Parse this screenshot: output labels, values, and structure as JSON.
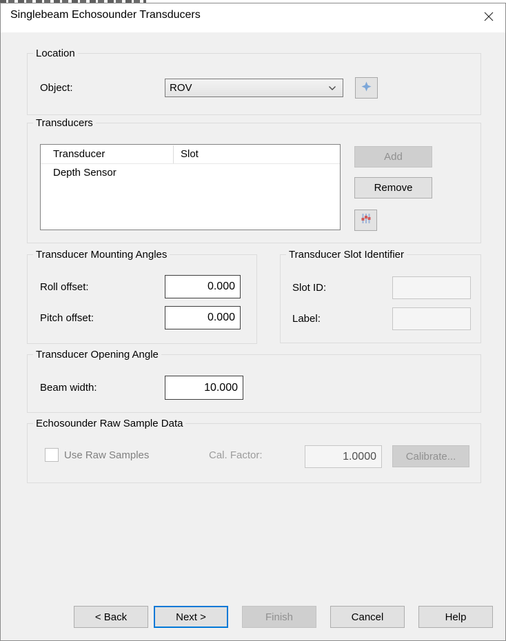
{
  "window": {
    "title": "Singlebeam Echosounder Transducers"
  },
  "location": {
    "legend": "Location",
    "object_label": "Object:",
    "object_value": "ROV"
  },
  "transducers": {
    "legend": "Transducers",
    "columns": {
      "transducer": "Transducer",
      "slot": "Slot"
    },
    "rows": [
      {
        "transducer": "Depth Sensor",
        "slot": ""
      }
    ],
    "add_label": "Add",
    "remove_label": "Remove"
  },
  "mounting_angles": {
    "legend": "Transducer Mounting Angles",
    "roll_label": "Roll offset:",
    "roll_value": "0.000",
    "pitch_label": "Pitch offset:",
    "pitch_value": "0.000"
  },
  "slot_identifier": {
    "legend": "Transducer Slot Identifier",
    "slot_id_label": "Slot ID:",
    "slot_id_value": "",
    "label_label": "Label:",
    "label_value": ""
  },
  "opening_angle": {
    "legend": "Transducer Opening Angle",
    "beam_width_label": "Beam width:",
    "beam_width_value": "10.000"
  },
  "raw_sample": {
    "legend": "Echosounder Raw Sample Data",
    "use_raw_samples_label": "Use Raw Samples",
    "use_raw_samples_checked": false,
    "cal_factor_label": "Cal. Factor:",
    "cal_factor_value": "1.0000",
    "calibrate_label": "Calibrate..."
  },
  "footer": {
    "back_label": "< Back",
    "next_label": "Next >",
    "finish_label": "Finish",
    "cancel_label": "Cancel",
    "help_label": "Help"
  },
  "icons": {
    "close": "close-icon",
    "combo_chevron": "chevron-down-icon",
    "add_object": "plus-icon",
    "transducer_settings": "sliders-icon"
  },
  "colors": {
    "accent": "#0078d7",
    "icon_blue": "#7da7d8",
    "icon_red": "#d05c5c",
    "dialog_bg": "#f0f0f0"
  }
}
